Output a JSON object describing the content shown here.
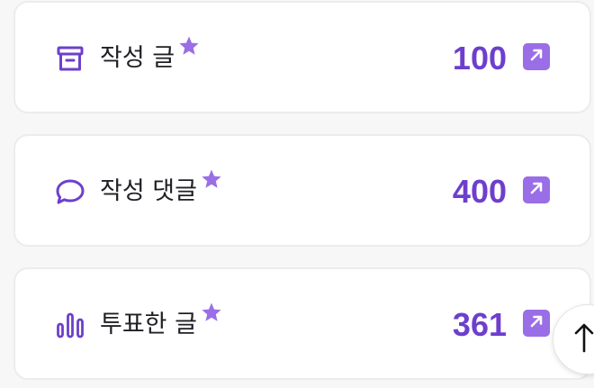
{
  "colors": {
    "accent": "#6d3fcc",
    "star": "#9a6ee6",
    "link_button": "#9a6ee6",
    "text": "#1f1f24"
  },
  "stats": [
    {
      "icon": "archive-box-icon",
      "label": "작성 글",
      "value": "100"
    },
    {
      "icon": "speech-bubble-icon",
      "label": "작성 댓글",
      "value": "400"
    },
    {
      "icon": "bar-chart-icon",
      "label": "투표한 글",
      "value": "361"
    }
  ],
  "scroll_top": {
    "icon": "arrow-up-icon"
  }
}
